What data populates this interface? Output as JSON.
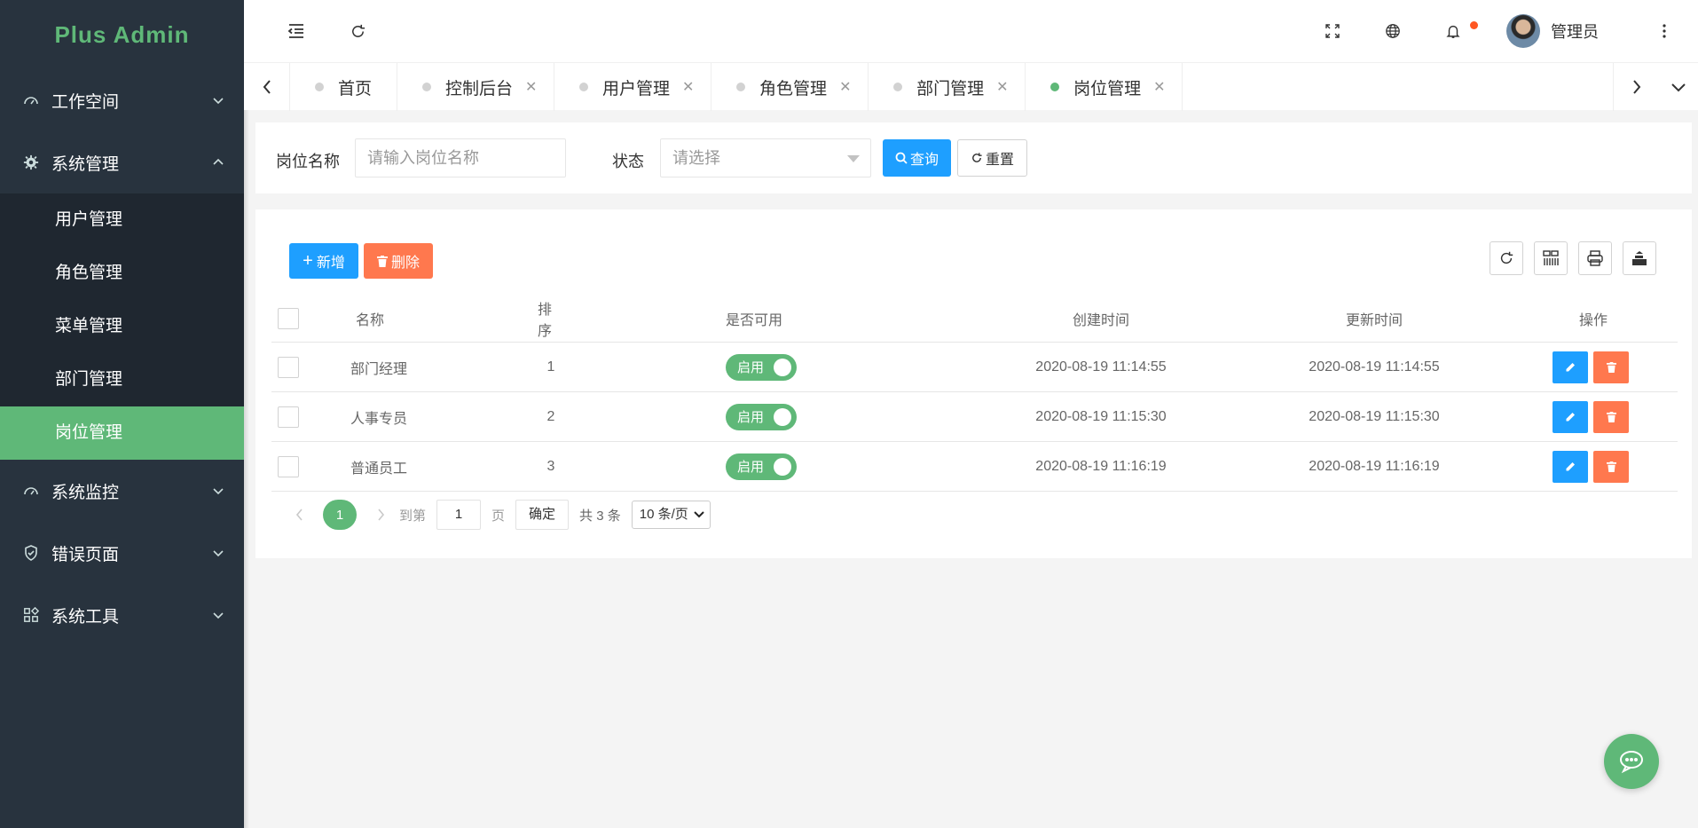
{
  "app": {
    "title": "Plus Admin"
  },
  "sidebar": {
    "groups": [
      {
        "label": "工作空间",
        "icon": "dashboard-icon",
        "expanded": false
      },
      {
        "label": "系统管理",
        "icon": "gear-icon",
        "expanded": true,
        "items": [
          {
            "label": "用户管理",
            "active": false
          },
          {
            "label": "角色管理",
            "active": false
          },
          {
            "label": "菜单管理",
            "active": false
          },
          {
            "label": "部门管理",
            "active": false
          },
          {
            "label": "岗位管理",
            "active": true
          }
        ]
      },
      {
        "label": "系统监控",
        "icon": "monitor-icon",
        "expanded": false
      },
      {
        "label": "错误页面",
        "icon": "shield-icon",
        "expanded": false
      },
      {
        "label": "系统工具",
        "icon": "apps-icon",
        "expanded": false
      }
    ]
  },
  "header": {
    "user_name": "管理员",
    "icons": [
      "menu-fold-icon",
      "refresh-icon",
      "fullscreen-icon",
      "globe-icon",
      "bell-icon",
      "more-vertical-icon"
    ]
  },
  "tabs": [
    {
      "label": "首页",
      "closable": false,
      "active": false
    },
    {
      "label": "控制后台",
      "closable": true,
      "active": false
    },
    {
      "label": "用户管理",
      "closable": true,
      "active": false
    },
    {
      "label": "角色管理",
      "closable": true,
      "active": false
    },
    {
      "label": "部门管理",
      "closable": true,
      "active": false
    },
    {
      "label": "岗位管理",
      "closable": true,
      "active": true
    }
  ],
  "search": {
    "name_label": "岗位名称",
    "name_placeholder": "请输入岗位名称",
    "status_label": "状态",
    "status_placeholder": "请选择",
    "query_label": "查询",
    "reset_label": "重置"
  },
  "toolbar": {
    "add_label": "新增",
    "delete_label": "删除"
  },
  "table": {
    "columns": [
      "名称",
      "排序",
      "是否可用",
      "创建时间",
      "更新时间",
      "操作"
    ],
    "rows": [
      {
        "name": "部门经理",
        "sort": "1",
        "status": "启用",
        "created": "2020-08-19 11:14:55",
        "updated": "2020-08-19 11:14:55"
      },
      {
        "name": "人事专员",
        "sort": "2",
        "status": "启用",
        "created": "2020-08-19 11:15:30",
        "updated": "2020-08-19 11:15:30"
      },
      {
        "name": "普通员工",
        "sort": "3",
        "status": "启用",
        "created": "2020-08-19 11:16:19",
        "updated": "2020-08-19 11:16:19"
      }
    ]
  },
  "pager": {
    "current": "1",
    "goto_label": "到第",
    "goto_value": "1",
    "page_unit": "页",
    "confirm_label": "确定",
    "total_label": "共 3 条",
    "page_size": "10 条/页"
  },
  "colors": {
    "sidebar": "#28333e",
    "accent": "#5fb878",
    "primary": "#1e9fff",
    "danger": "#ff5722"
  }
}
